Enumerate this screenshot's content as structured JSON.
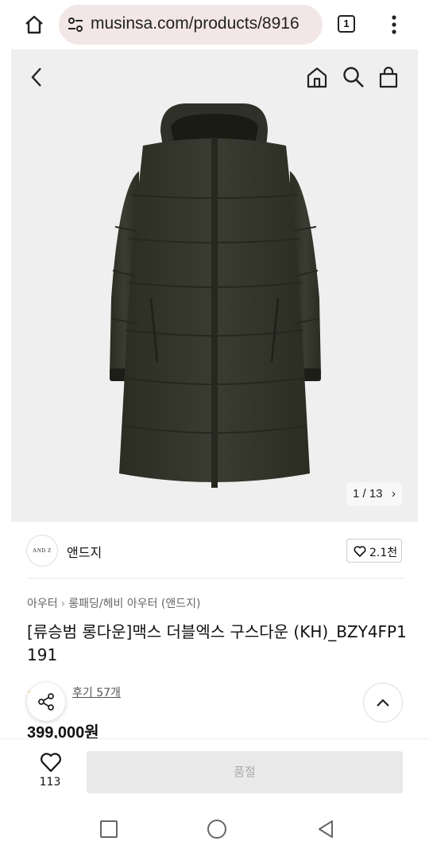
{
  "browser": {
    "url": "musinsa.com/products/8916",
    "tab_count": "1"
  },
  "gallery": {
    "pager_text": "1 / 13"
  },
  "brand": {
    "logo_text": "AND Z",
    "name": "앤드지",
    "like_count": "2.1천"
  },
  "breadcrumb": {
    "category": "아우터",
    "subcategory": "롱패딩/헤비 아우터 (앤드지)"
  },
  "product": {
    "title": "[류승범 롱다운]맥스 더블엑스 구스다운 (KH)_BZY4FP1191",
    "review_text": "후기 57개",
    "price": "399,000원"
  },
  "bottom": {
    "like_count": "113",
    "buy_label": "품절"
  },
  "colors": {
    "coat": "#3a3b30",
    "background": "#efefef",
    "url_pill": "#f2e6e6"
  }
}
